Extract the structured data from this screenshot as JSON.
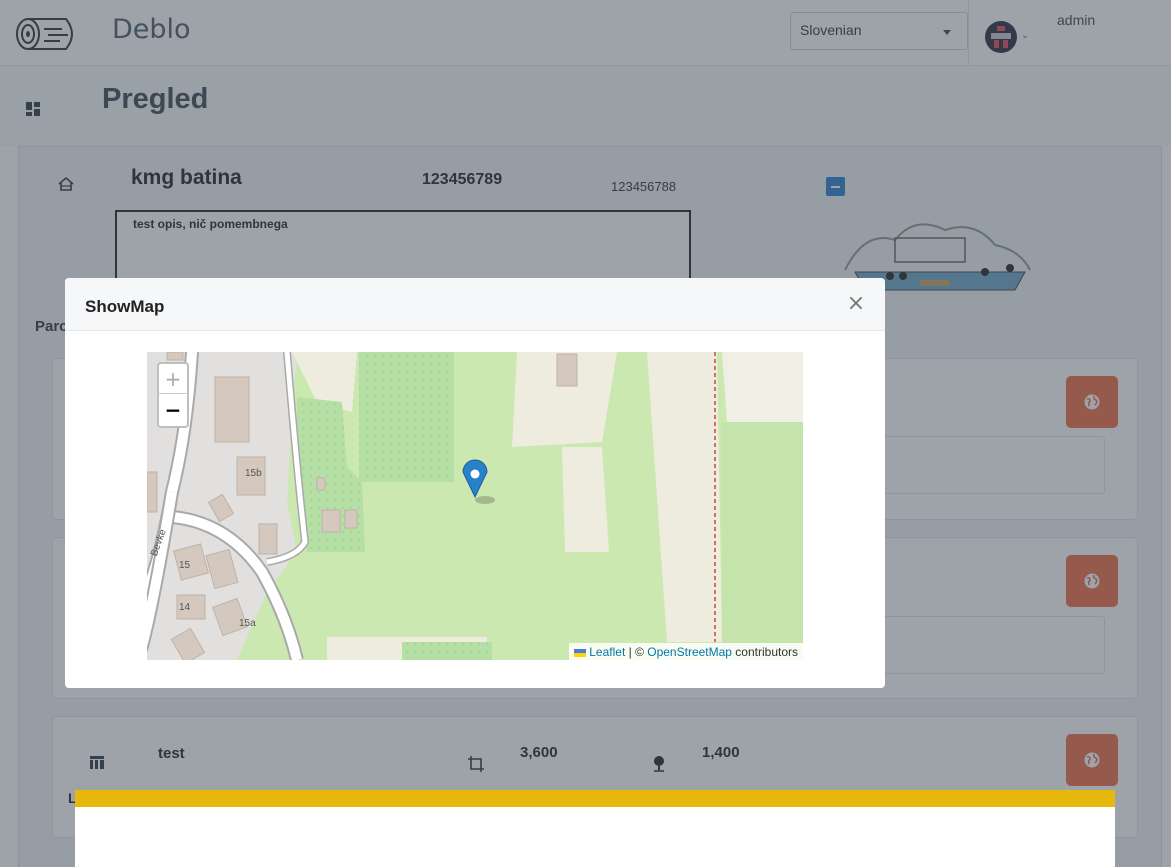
{
  "header": {
    "app_title": "Deblo",
    "language": "Slovenian",
    "user": "admin"
  },
  "page": {
    "title": "Pregled"
  },
  "farm": {
    "name": "kmg batina",
    "number_primary": "123456789",
    "number_secondary": "123456788",
    "description": "test opis, nič pomembnega"
  },
  "parcels_section": {
    "label": "Parc"
  },
  "parcel": {
    "name": "test",
    "area": "3,600",
    "second_value": "1,400",
    "letter": "L"
  },
  "modal": {
    "title": "ShowMap",
    "close": "×"
  },
  "map": {
    "zoom_in": "+",
    "zoom_out": "−",
    "attribution": {
      "leaflet": "Leaflet",
      "separator": " | © ",
      "osm": "OpenStreetMap",
      "suffix": " contributors"
    },
    "labels": {
      "house_15b": "15b",
      "house_15": "15",
      "house_14": "14",
      "house_15a": "15a",
      "street": "Bevke"
    }
  },
  "colors": {
    "accent_blue": "#2a7fce",
    "globe_button": "#f06c44",
    "banner_yellow": "#e6b80b",
    "map_marker": "#2a81cb"
  }
}
